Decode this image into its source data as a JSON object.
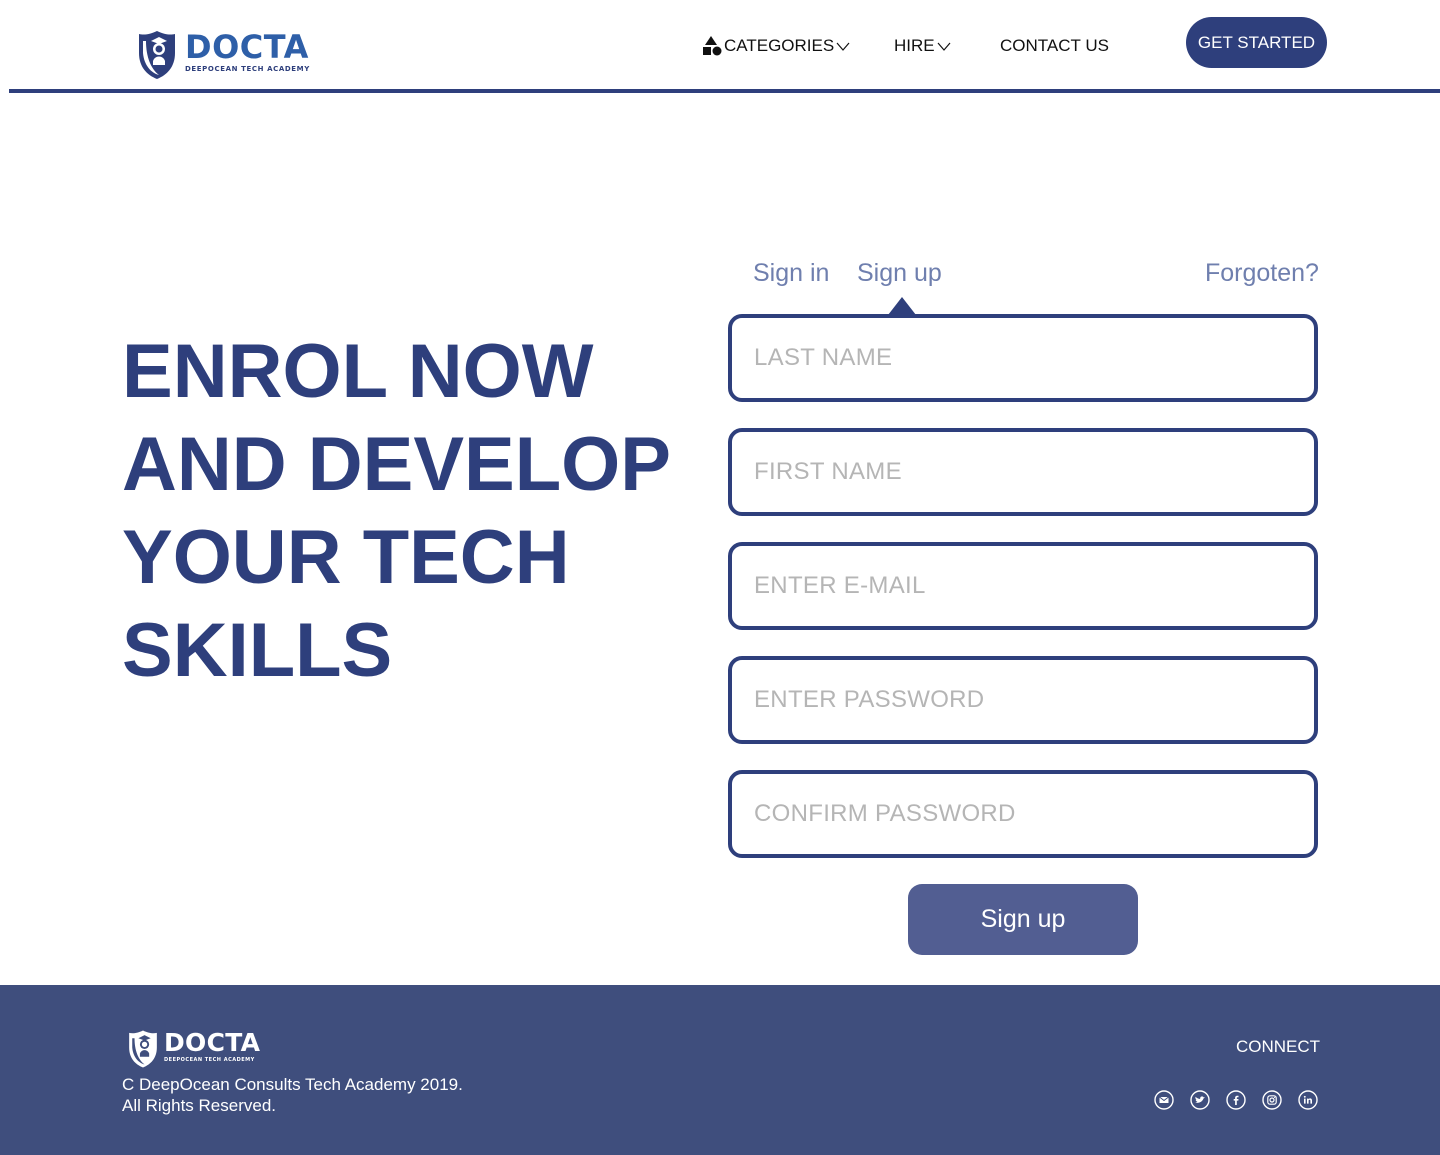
{
  "header": {
    "logo": {
      "word": "DOCTA",
      "subtitle": "DEEPOCEAN TECH ACADEMY",
      "icon": "shield-graduate-icon"
    },
    "nav": {
      "categories": "CATEGORIES",
      "hire": "HIRE",
      "contact": "CONTACT US"
    },
    "cta": "GET STARTED"
  },
  "hero": {
    "lines": [
      "ENROL NOW",
      "AND DEVELOP",
      "YOUR TECH",
      "SKILLS"
    ]
  },
  "form": {
    "tabs": {
      "signin": "Sign in",
      "signup": "Sign up",
      "forgot": "Forgoten?"
    },
    "active_tab": "Sign up",
    "fields": {
      "last_name": "LAST NAME",
      "first_name": "FIRST NAME",
      "email": "ENTER E-MAIL",
      "password": "ENTER PASSWORD",
      "confirm_password": "CONFIRM PASSWORD"
    },
    "submit": "Sign up"
  },
  "footer": {
    "logo": {
      "word": "DOCTA",
      "subtitle": "DEEPOCEAN TECH ACADEMY"
    },
    "copyright_line1": "C DeepOcean Consults Tech Academy 2019.",
    "copyright_line2": "All Rights Reserved.",
    "connect": "CONNECT",
    "social_icons": [
      "email-icon",
      "twitter-icon",
      "facebook-icon",
      "instagram-icon",
      "linkedin-icon"
    ]
  },
  "colors": {
    "primary": "#2e3f7c",
    "footer_bg": "#3f4e7d",
    "button": "#525e92",
    "tab_text": "#6f7fae",
    "placeholder": "#b5b5b5"
  }
}
